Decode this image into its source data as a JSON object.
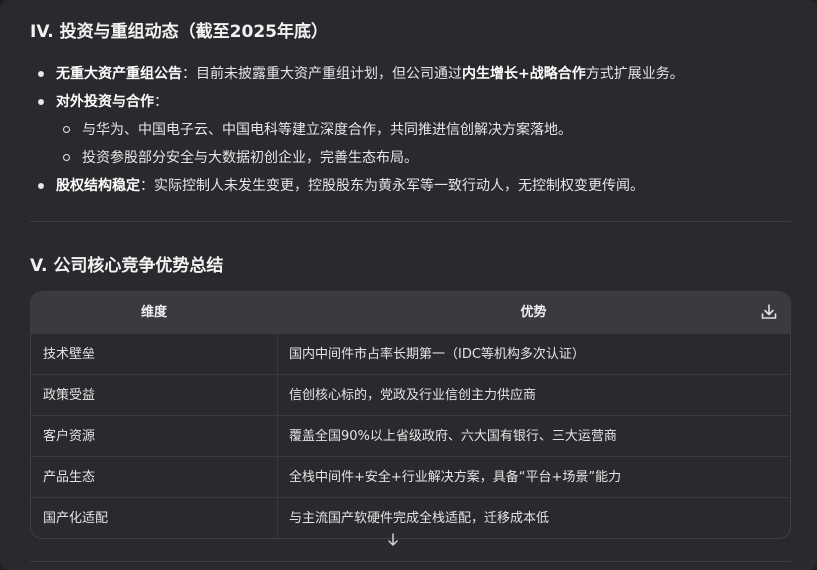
{
  "section4": {
    "title": "IV. 投资与重组动态（截至2025年底）",
    "items": [
      {
        "bold": "无重大资产重组公告",
        "text_a": "：目前未披露重大资产重组计划，但公司通过",
        "bold2": "内生增长+战略合作",
        "text_b": "方式扩展业务。"
      },
      {
        "bold": "对外投资与合作",
        "text_a": "："
      },
      {
        "sub": "与华为、中国电子云、中国电科等建立深度合作，共同推进信创解决方案落地。"
      },
      {
        "sub": "投资参股部分安全与大数据初创企业，完善生态布局。"
      },
      {
        "bold": "股权结构稳定",
        "text_a": "：实际控制人未发生变更，控股股东为黄永军等一致行动人，无控制权变更传闻。"
      }
    ]
  },
  "section5": {
    "title": "V. 公司核心竞争优势总结"
  },
  "table": {
    "headers": [
      "维度",
      "优势"
    ],
    "download_icon": "download-icon",
    "rows": [
      [
        "技术壁垒",
        "国内中间件市占率长期第一（IDC等机构多次认证）"
      ],
      [
        "政策受益",
        "信创核心标的，党政及行业信创主力供应商"
      ],
      [
        "客户资源",
        "覆盖全国90%以上省级政府、六大国有银行、三大运营商"
      ],
      [
        "产品生态",
        "全栈中间件+安全+行业解决方案，具备“平台+场景”能力"
      ],
      [
        "国产化适配",
        "与主流国产软硬件完成全栈适配，迁移成本低"
      ]
    ]
  },
  "scroll_icon": "arrow-down-icon"
}
